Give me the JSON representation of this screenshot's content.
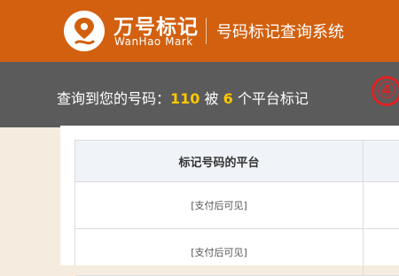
{
  "header": {
    "brand_cn": "万号标记",
    "brand_en": "WanHao Mark",
    "system_title": "号码标记查询系统"
  },
  "result": {
    "prefix": "查询到您的号码：",
    "number": "110",
    "mid": " 被 ",
    "count": "6",
    "suffix": " 个平台标记",
    "badge": "④"
  },
  "table": {
    "header": "标记号码的平台",
    "rows": [
      "[支付后可见]",
      "[支付后可见]"
    ]
  },
  "colors": {
    "header_bg": "#d2600f",
    "band_bg": "#5b5b5b",
    "highlight": "#ffc800",
    "badge_red": "#e02020"
  }
}
